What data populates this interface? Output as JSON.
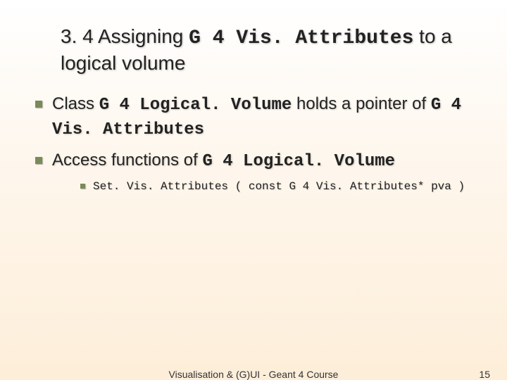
{
  "title": {
    "prefix": "3. 4 Assigning ",
    "code": "G 4 Vis. Attributes",
    "suffix": " to a logical volume"
  },
  "bullets": [
    {
      "parts": [
        {
          "t": "Class ",
          "code": false
        },
        {
          "t": "G 4 Logical. Volume",
          "code": true
        },
        {
          "t": " holds a pointer of ",
          "code": false
        },
        {
          "t": "G 4 Vis. Attributes",
          "code": true
        }
      ]
    },
    {
      "parts": [
        {
          "t": "Access functions of ",
          "code": false
        },
        {
          "t": "G 4 Logical. Volume",
          "code": true
        }
      ],
      "sub": [
        {
          "t": "Set. Vis. Attributes ( const G 4 Vis. Attributes* pva )"
        }
      ]
    }
  ],
  "footer": {
    "center": "Visualisation & (G)UI - Geant 4 Course",
    "page": "15"
  }
}
